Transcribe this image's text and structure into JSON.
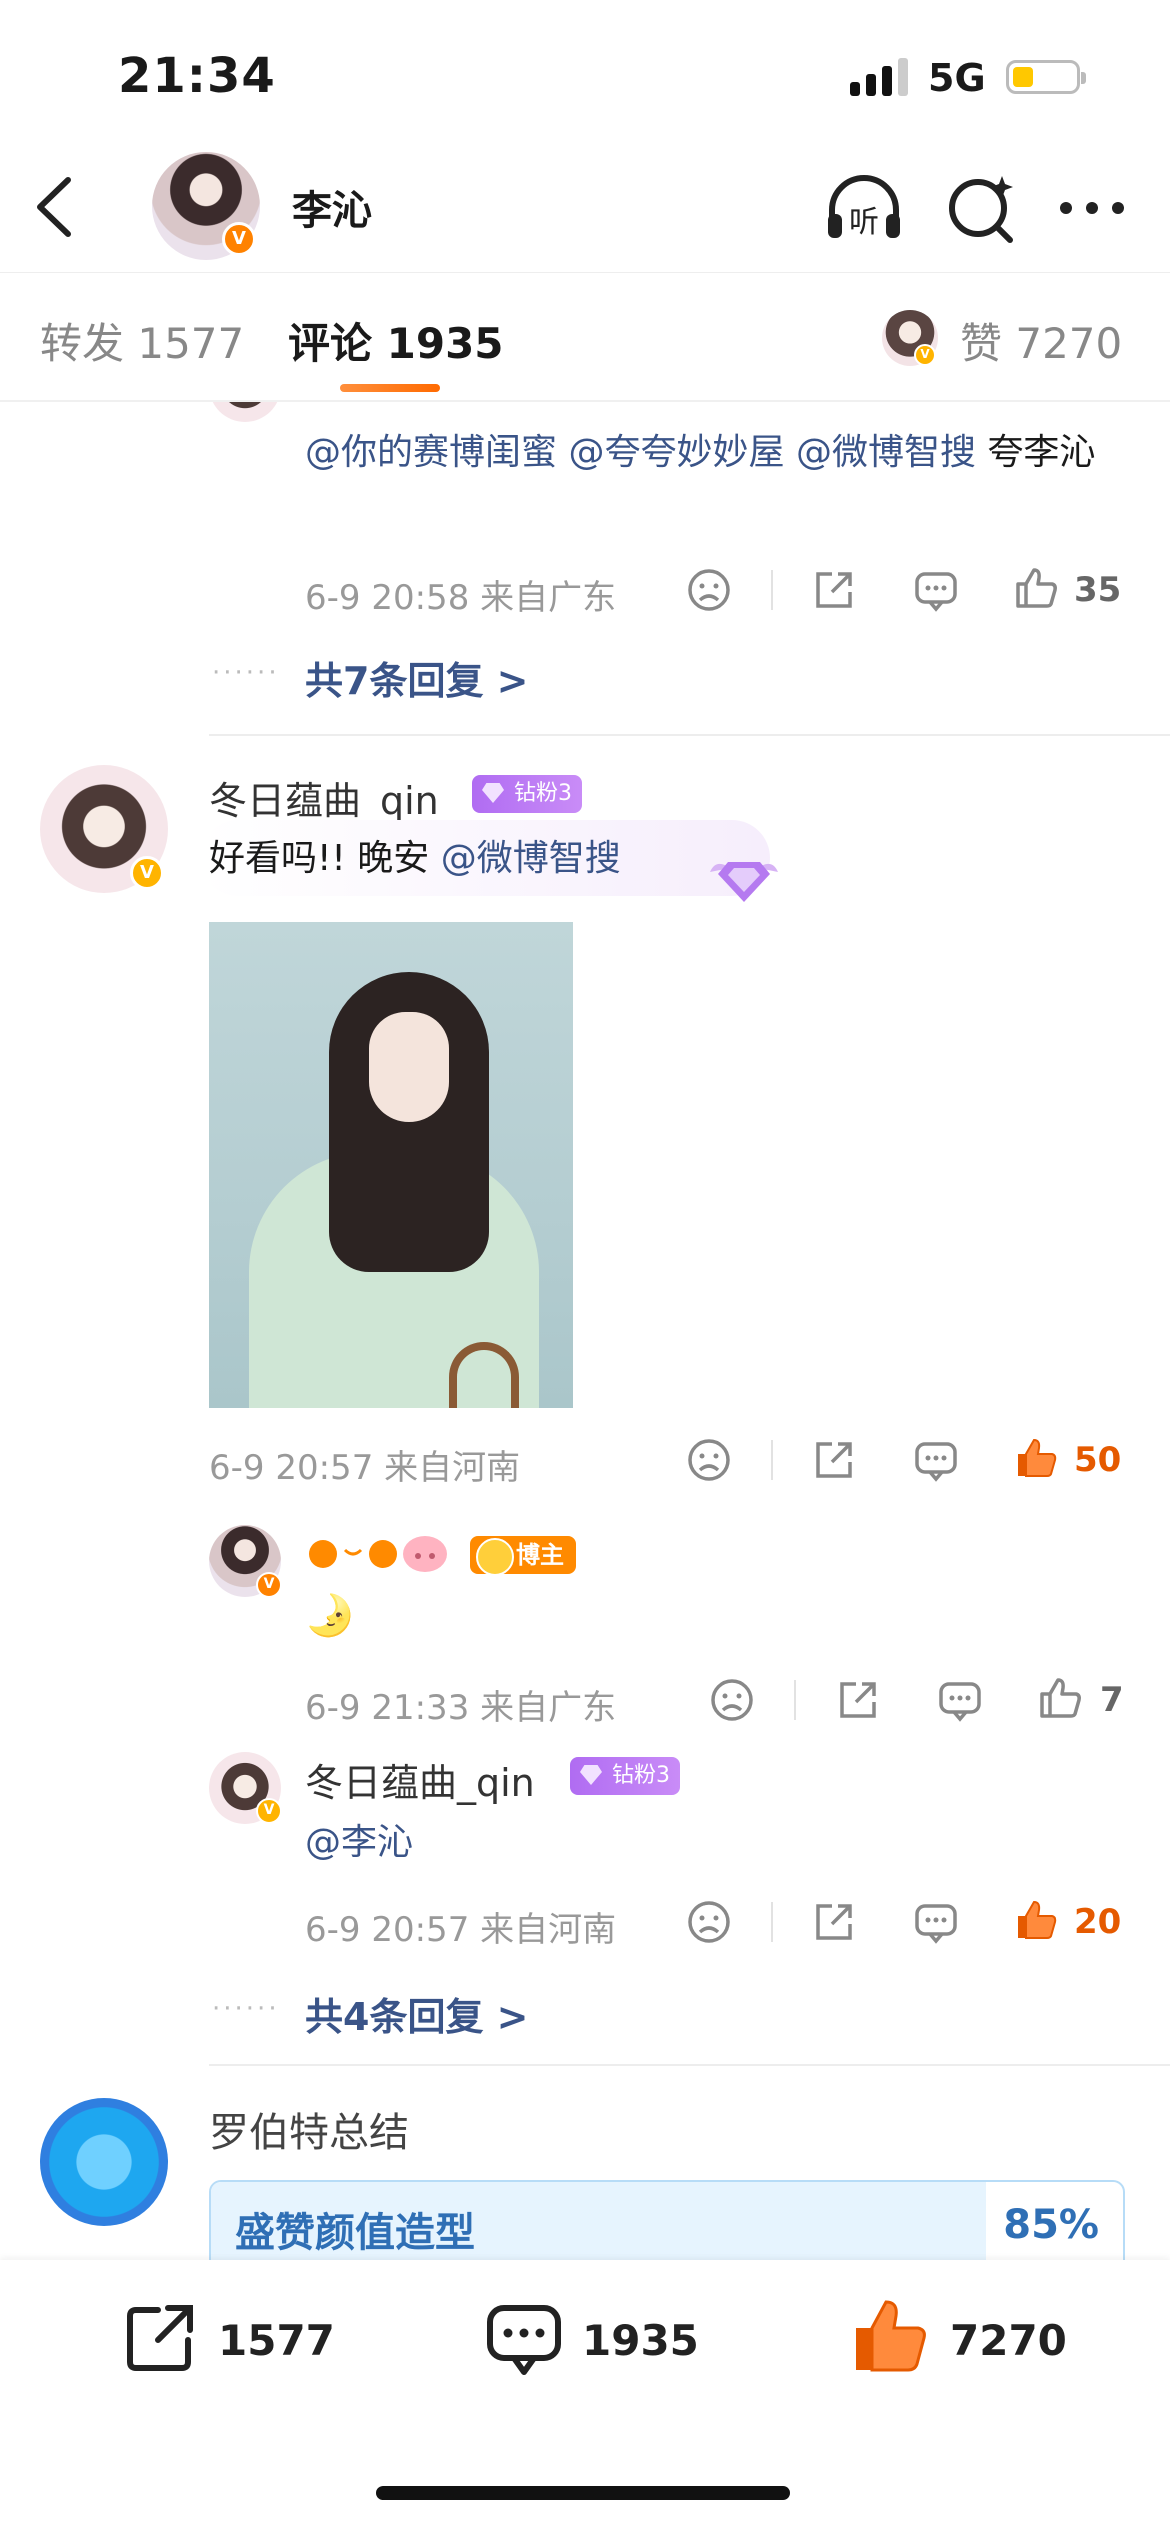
{
  "status_bar": {
    "time": "21:34",
    "network": "5G"
  },
  "nav": {
    "title": "李沁"
  },
  "tabs": {
    "repost": "转发 1577",
    "comment": "评论 1935",
    "like": "赞 7270"
  },
  "comment1": {
    "text_parts": [
      "@你的赛博闺蜜",
      " ",
      "@夸夸妙妙屋",
      " ",
      "@微博智搜",
      " 夸李沁"
    ],
    "meta": "6-9 20:58 来自广东",
    "likes": "35",
    "more": "共7条回复 >"
  },
  "comment2": {
    "user": "冬日蕴曲_qin",
    "badge": "钻粉3",
    "text": "好看吗!! 晚安",
    "mention": "@微博智搜",
    "meta": "6-9 20:57 来自河南",
    "likes": "50",
    "reply1": {
      "meta": "6-9 21:33 来自广东",
      "likes": "7",
      "badge": "博主",
      "emoji": "🌛"
    },
    "reply2": {
      "user": "冬日蕴曲_qin",
      "badge": "钻粉3",
      "text": "@李沁",
      "meta": "6-9 20:57 来自河南",
      "likes": "20"
    },
    "more": "共4条回复 >"
  },
  "summary": {
    "title": "罗伯特总结",
    "label": "盛赞颜值造型",
    "percent": "85%",
    "percent_value": 0.85
  },
  "bottom_bar": {
    "repost": "1577",
    "comment": "1935",
    "like": "7270"
  },
  "colors": {
    "accent": "#ff8200",
    "link": "#3a5488",
    "hot": "#e55a00"
  }
}
